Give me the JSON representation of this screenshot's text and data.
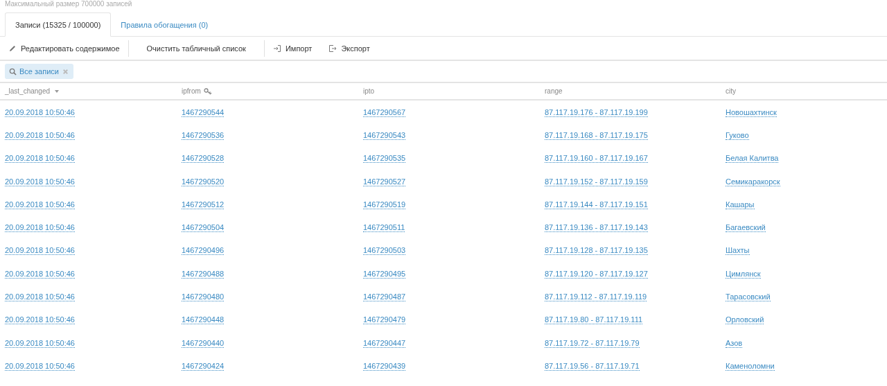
{
  "limit_note": "Максимальный размер 700000 записей",
  "tabs": [
    {
      "label": "Записи (15325 / 100000)",
      "selected": true
    },
    {
      "label": "Правила обогащения (0)",
      "selected": false
    }
  ],
  "toolbar": [
    {
      "kind": "edit",
      "label": "Редактировать содержимое"
    },
    {
      "kind": "plain",
      "label": "Очистить табличный список"
    },
    {
      "kind": "import",
      "label": "Импорт"
    },
    {
      "kind": "export",
      "label": "Экспорт"
    }
  ],
  "filter_chip": {
    "label": "Все записи"
  },
  "table": {
    "columns": [
      {
        "label": "_last_changed",
        "kind": "sort"
      },
      {
        "label": "ipfrom",
        "kind": "key"
      },
      {
        "label": "ipto",
        "kind": "plain"
      },
      {
        "label": "range",
        "kind": "plain"
      },
      {
        "label": "city",
        "kind": "plain"
      }
    ],
    "rows": [
      [
        "20.09.2018 10:50:46",
        "1467290544",
        "1467290567",
        "87.117.19.176 - 87.117.19.199",
        "Новошахтинск"
      ],
      [
        "20.09.2018 10:50:46",
        "1467290536",
        "1467290543",
        "87.117.19.168 - 87.117.19.175",
        "Гуково"
      ],
      [
        "20.09.2018 10:50:46",
        "1467290528",
        "1467290535",
        "87.117.19.160 - 87.117.19.167",
        "Белая Калитва"
      ],
      [
        "20.09.2018 10:50:46",
        "1467290520",
        "1467290527",
        "87.117.19.152 - 87.117.19.159",
        "Семикаракорск"
      ],
      [
        "20.09.2018 10:50:46",
        "1467290512",
        "1467290519",
        "87.117.19.144 - 87.117.19.151",
        "Кашары"
      ],
      [
        "20.09.2018 10:50:46",
        "1467290504",
        "1467290511",
        "87.117.19.136 - 87.117.19.143",
        "Багаевский"
      ],
      [
        "20.09.2018 10:50:46",
        "1467290496",
        "1467290503",
        "87.117.19.128 - 87.117.19.135",
        "Шахты"
      ],
      [
        "20.09.2018 10:50:46",
        "1467290488",
        "1467290495",
        "87.117.19.120 - 87.117.19.127",
        "Цимлянск"
      ],
      [
        "20.09.2018 10:50:46",
        "1467290480",
        "1467290487",
        "87.117.19.112 - 87.117.19.119",
        "Тарасовский"
      ],
      [
        "20.09.2018 10:50:46",
        "1467290448",
        "1467290479",
        "87.117.19.80 - 87.117.19.111",
        "Орловский"
      ],
      [
        "20.09.2018 10:50:46",
        "1467290440",
        "1467290447",
        "87.117.19.72 - 87.117.19.79",
        "Азов"
      ],
      [
        "20.09.2018 10:50:46",
        "1467290424",
        "1467290439",
        "87.117.19.56 - 87.117.19.71",
        "Каменоломни"
      ]
    ]
  }
}
